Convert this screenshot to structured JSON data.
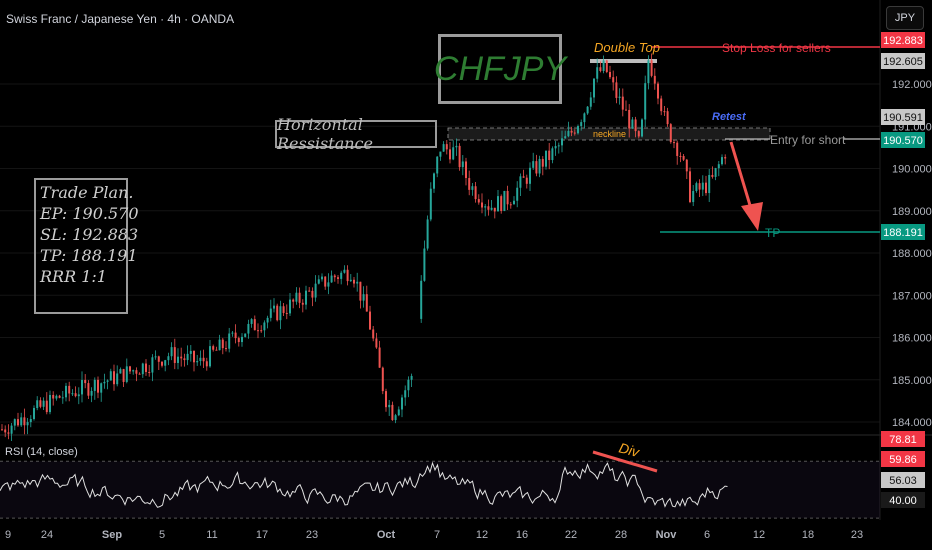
{
  "header": {
    "title": "Swiss Franc / Japanese Yen · 4h · OANDA",
    "currency_button": "JPY"
  },
  "annotations": {
    "pair": "CHFJPY",
    "horizontal_resistance": "Horizontal Ressistance",
    "double_top": "Double Top",
    "stop_loss": "Stop Loss for sellers",
    "neckline": "neckline",
    "retest": "Retest",
    "entry": "Entry for short",
    "tp": "TP",
    "div": "Div",
    "plan": [
      "Trade Plan.",
      "EP: 190.570",
      "SL: 192.883",
      "TP: 188.191",
      "RRR 1:1"
    ]
  },
  "colors": {
    "up": "#26a69a",
    "down": "#ef5350",
    "bg": "#000000",
    "sl": "#f23645",
    "tp_line": "#089981",
    "neckline": "#b0b0b0",
    "double_top": "#f5a623",
    "retest": "#4a6cf7"
  },
  "chart_data": [
    {
      "type": "candlestick",
      "title": "Swiss Franc / Japanese Yen · 4h · OANDA",
      "ylim": [
        183.4,
        193.0
      ],
      "y_ticks": [
        184.0,
        185.0,
        186.0,
        187.0,
        188.0,
        189.0,
        190.0,
        191.0,
        192.0
      ],
      "x_ticks": [
        "9",
        "24",
        "Sep",
        "5",
        "11",
        "17",
        "23",
        "Oct",
        "7",
        "12",
        "16",
        "22",
        "28",
        "Nov",
        "6",
        "12",
        "18",
        "23"
      ],
      "close_path_x_index": [
        0,
        22,
        44,
        66,
        88,
        110,
        132,
        154,
        176,
        198,
        220,
        242,
        264,
        286,
        308,
        330,
        352,
        374,
        396,
        418,
        440,
        462,
        484,
        506,
        528,
        550,
        572,
        594,
        616,
        638,
        660,
        682,
        704,
        726
      ],
      "close_path_y": [
        183.8,
        184.5,
        184.6,
        185.2,
        185.0,
        185.8,
        185.5,
        186.2,
        185.6,
        186.7,
        186.0,
        186.6,
        186.2,
        186.8,
        186.3,
        187.0,
        186.7,
        187.4,
        186.9,
        187.1,
        186.4,
        187.6,
        185.0,
        184.2,
        184.8,
        188.2,
        190.2,
        190.6,
        189.6,
        189.3,
        189.0,
        189.5,
        189.9,
        190.3,
        190.8
      ],
      "price_labels": [
        {
          "value": "192.883",
          "color": "#f23645"
        },
        {
          "value": "192.605",
          "color": "#c8c8c8"
        },
        {
          "value": "190.591",
          "color": "#c8c8c8"
        },
        {
          "value": "190.570",
          "color": "#089981"
        },
        {
          "value": "188.191",
          "color": "#089981"
        }
      ],
      "levels": {
        "stop_loss": 192.883,
        "neckline": 190.591,
        "entry": 190.57,
        "tp": 188.191
      }
    },
    {
      "type": "line",
      "title": "RSI (14, close)",
      "ylim": [
        35,
        80
      ],
      "levels": [
        70,
        30
      ],
      "price_labels": [
        {
          "value": "78.81",
          "color": "#f23645"
        },
        {
          "value": "59.86",
          "color": "#f23645"
        },
        {
          "value": "56.03",
          "color": "#c8c8c8"
        },
        {
          "value": "40.00",
          "color": "#1a1a1a"
        }
      ]
    }
  ]
}
